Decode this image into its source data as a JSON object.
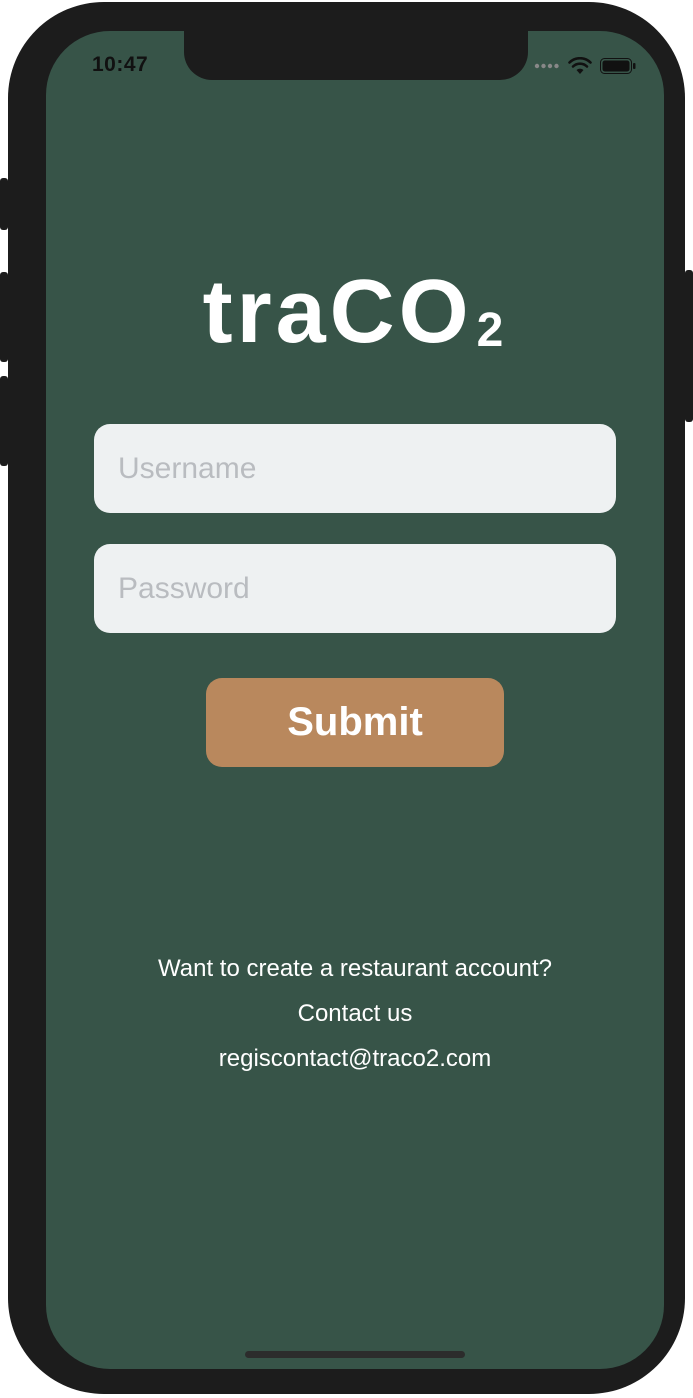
{
  "status_bar": {
    "time": "10:47"
  },
  "logo": {
    "main": "traCO",
    "subscript": "2"
  },
  "form": {
    "username_placeholder": "Username",
    "password_placeholder": "Password",
    "submit_label": "Submit"
  },
  "info": {
    "line1": "Want to create a restaurant account?",
    "line2": "Contact us",
    "line3": "regiscontact@traco2.com"
  },
  "colors": {
    "background": "#375448",
    "accent": "#b9885d",
    "field": "#eef1f2"
  }
}
